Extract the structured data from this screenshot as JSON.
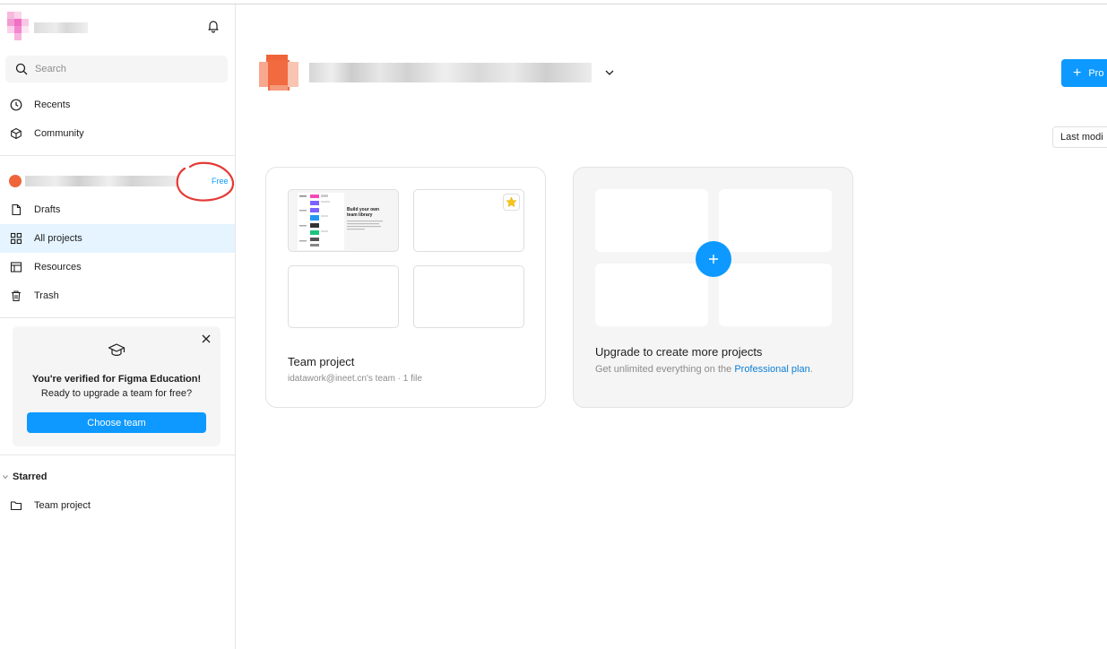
{
  "colors": {
    "accent": "#0d99ff",
    "active_nav_bg": "#e5f4ff",
    "annotation": "#e53935",
    "star": "#f5c518"
  },
  "sidebar": {
    "search": {
      "placeholder": "Search"
    },
    "top_items": [
      {
        "label": "Recents",
        "icon": "clock-icon"
      },
      {
        "label": "Community",
        "icon": "community-icon"
      }
    ],
    "team": {
      "badge": "Free"
    },
    "team_items": [
      {
        "label": "Drafts",
        "icon": "file-icon"
      },
      {
        "label": "All projects",
        "icon": "grid-icon",
        "active": true
      },
      {
        "label": "Resources",
        "icon": "resources-icon"
      },
      {
        "label": "Trash",
        "icon": "trash-icon"
      }
    ],
    "education": {
      "title": "You're verified for Figma Education!",
      "text": "Ready to upgrade a team for free?",
      "button": "Choose team"
    },
    "starred": {
      "heading": "Starred",
      "items": [
        {
          "label": "Team project",
          "icon": "folder-icon"
        }
      ]
    }
  },
  "main": {
    "new_project_button": "Pro",
    "sort_label": "Last modi",
    "project": {
      "title": "Team project",
      "subtitle": "idatawork@ineet.cn's team · 1 file",
      "thumbnail_heading": "Build your own team library"
    },
    "upgrade": {
      "title": "Upgrade to create more projects",
      "subtitle_prefix": "Get unlimited everything on the ",
      "link": "Professional plan",
      "suffix": "."
    }
  }
}
